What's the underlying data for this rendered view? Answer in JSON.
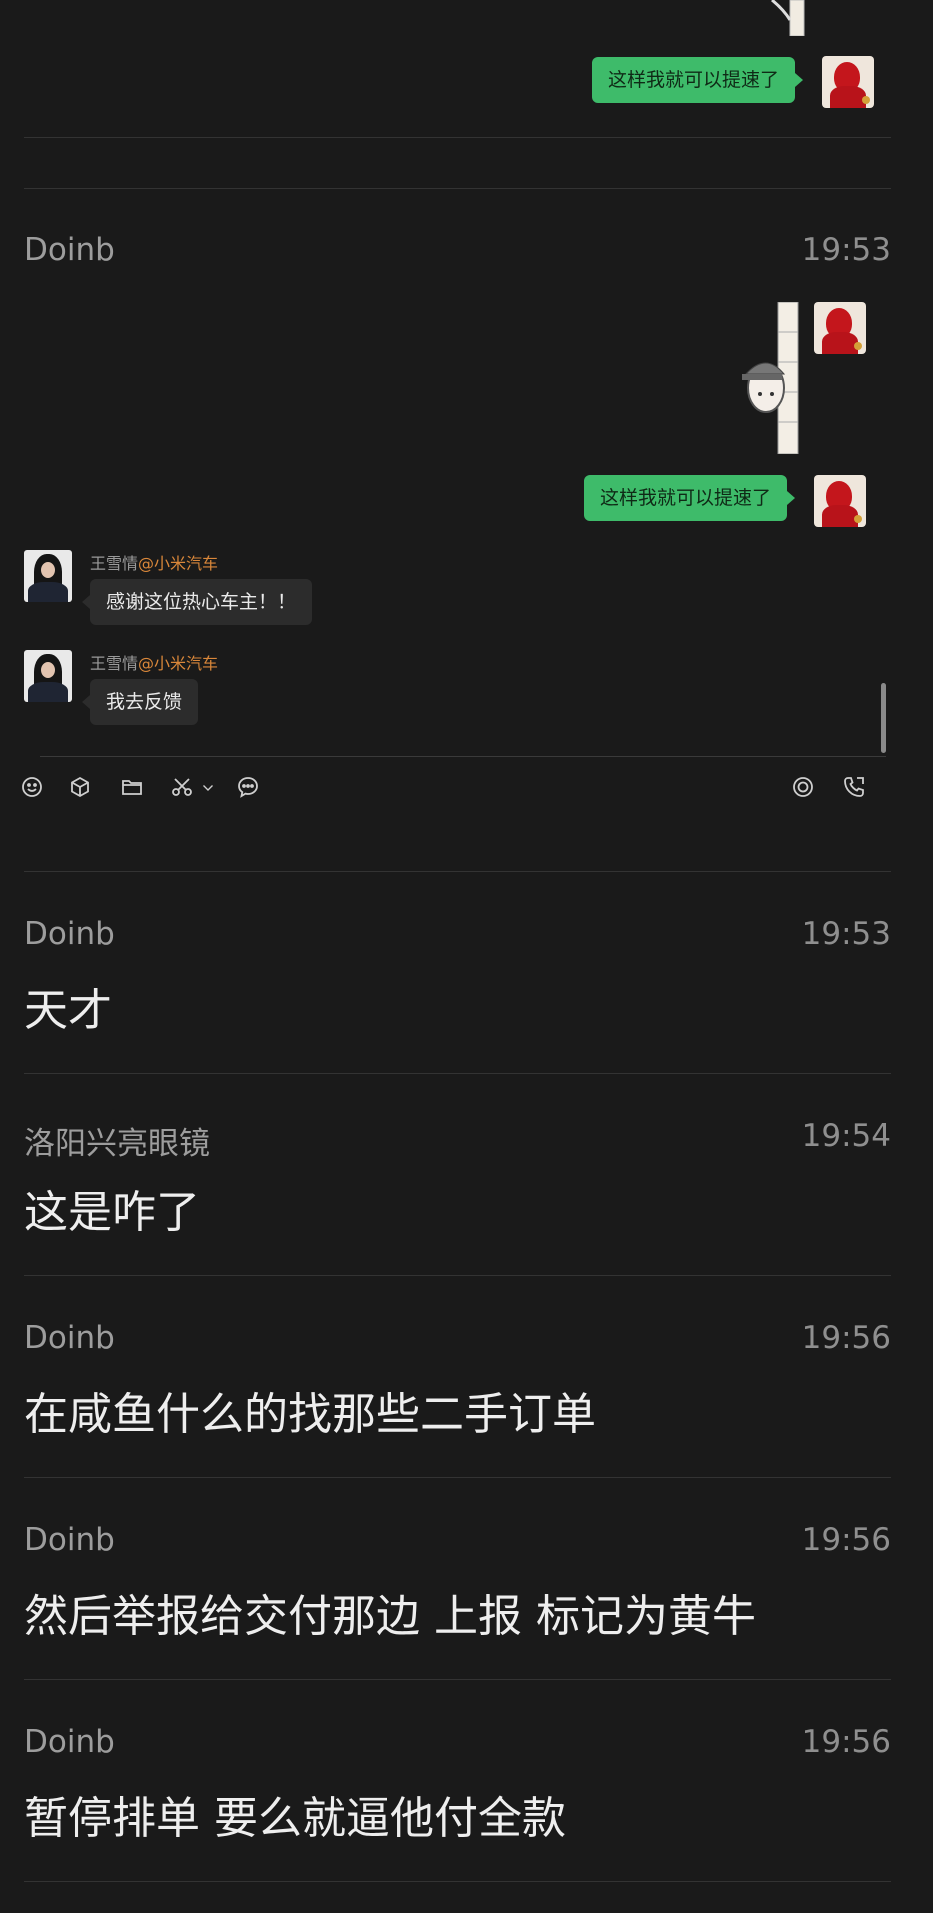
{
  "top_comment": {
    "sender": "Doinb",
    "time": "19:53"
  },
  "chat_messages": [
    {
      "type": "outgoing_text",
      "text": "这样我就可以提速了"
    },
    {
      "type": "outgoing_sticker"
    },
    {
      "type": "outgoing_text",
      "text": "这样我就可以提速了"
    },
    {
      "type": "incoming_text",
      "sender": "王雪情",
      "sender_tag": "@小米汽车",
      "text": "感谢这位热心车主！！"
    },
    {
      "type": "incoming_text",
      "sender": "王雪情",
      "sender_tag": "@小米汽车",
      "text": "我去反馈"
    }
  ],
  "toolbar": {
    "left_icons": [
      "emoji-icon",
      "cube-icon",
      "folder-icon",
      "scissors-icon",
      "chevron-down-icon",
      "chat-bubble-icon"
    ],
    "right_icons": [
      "record-icon",
      "phone-icon"
    ]
  },
  "comments": [
    {
      "name": "Doinb",
      "time": "19:53",
      "text": "天才"
    },
    {
      "name": "洛阳兴亮眼镜",
      "time": "19:54",
      "text": "这是咋了"
    },
    {
      "name": "Doinb",
      "time": "19:56",
      "text": "在咸鱼什么的找那些二手订单"
    },
    {
      "name": "Doinb",
      "time": "19:56",
      "text": "然后举报给交付那边 上报 标记为黄牛"
    },
    {
      "name": "Doinb",
      "time": "19:56",
      "text": "暂停排单 要么就逼他付全款"
    }
  ]
}
